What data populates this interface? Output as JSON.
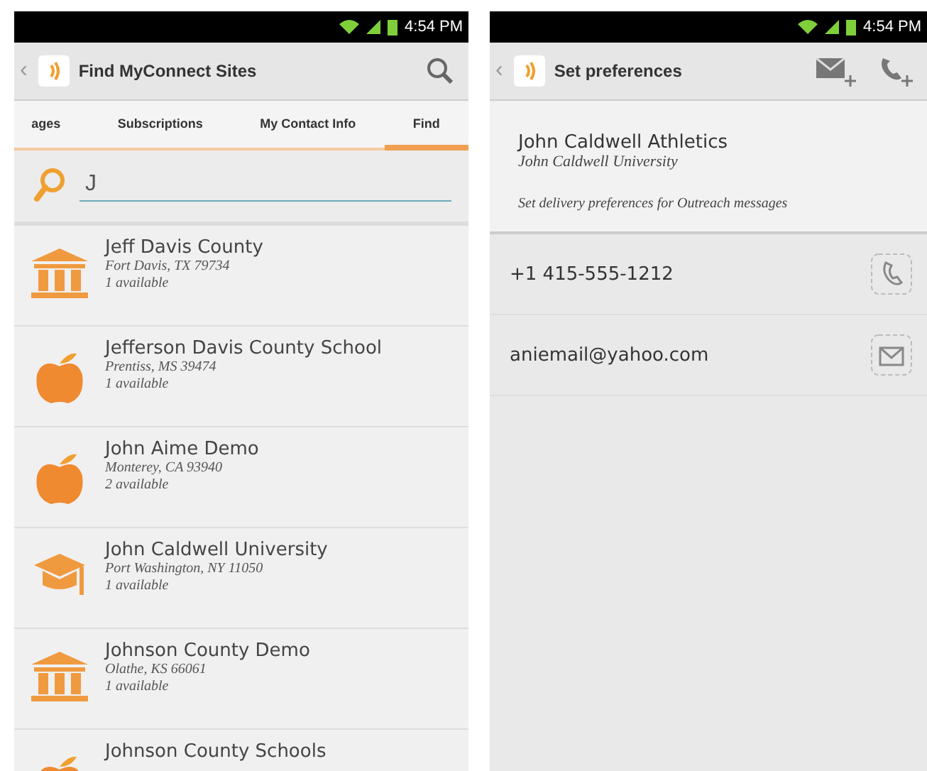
{
  "screens": [
    {
      "status_bar": {
        "time": "4:54 PM"
      },
      "action_bar": {
        "title": "Find MyConnect Sites",
        "back": "‹"
      },
      "tabs": [
        {
          "label": "ages",
          "selected": false
        },
        {
          "label": "Subscriptions",
          "selected": false
        },
        {
          "label": "My Contact Info",
          "selected": false
        },
        {
          "label": "Find",
          "selected": true
        }
      ],
      "search": {
        "value": "J"
      },
      "sites": [
        {
          "name": "Jeff Davis County",
          "location": "Fort Davis, TX  79734",
          "availability": "1 available",
          "kind": "building"
        },
        {
          "name": "Jefferson Davis County School",
          "location": "Prentiss, MS  39474",
          "availability": "1 available",
          "kind": "apple"
        },
        {
          "name": "John Aime Demo",
          "location": "Monterey, CA  93940",
          "availability": "2 available",
          "kind": "apple"
        },
        {
          "name": "John Caldwell University",
          "location": "Port Washington, NY  11050",
          "availability": "1 available",
          "kind": "cap"
        },
        {
          "name": "Johnson County Demo",
          "location": "Olathe, KS  66061",
          "availability": "1 available",
          "kind": "building"
        },
        {
          "name": "Johnson County Schools",
          "kind": "apple"
        }
      ]
    },
    {
      "status_bar": {
        "time": "4:54 PM"
      },
      "action_bar": {
        "title": "Set preferences",
        "back": "‹"
      },
      "subscription": {
        "name": "John Caldwell Athletics",
        "organization": "John Caldwell University",
        "description": "Set delivery preferences for Outreach messages"
      },
      "contacts": [
        {
          "value": "+1 415-555-1212",
          "kind": "phone"
        },
        {
          "value": "aniemail@yahoo.com",
          "kind": "email"
        }
      ]
    }
  ]
}
